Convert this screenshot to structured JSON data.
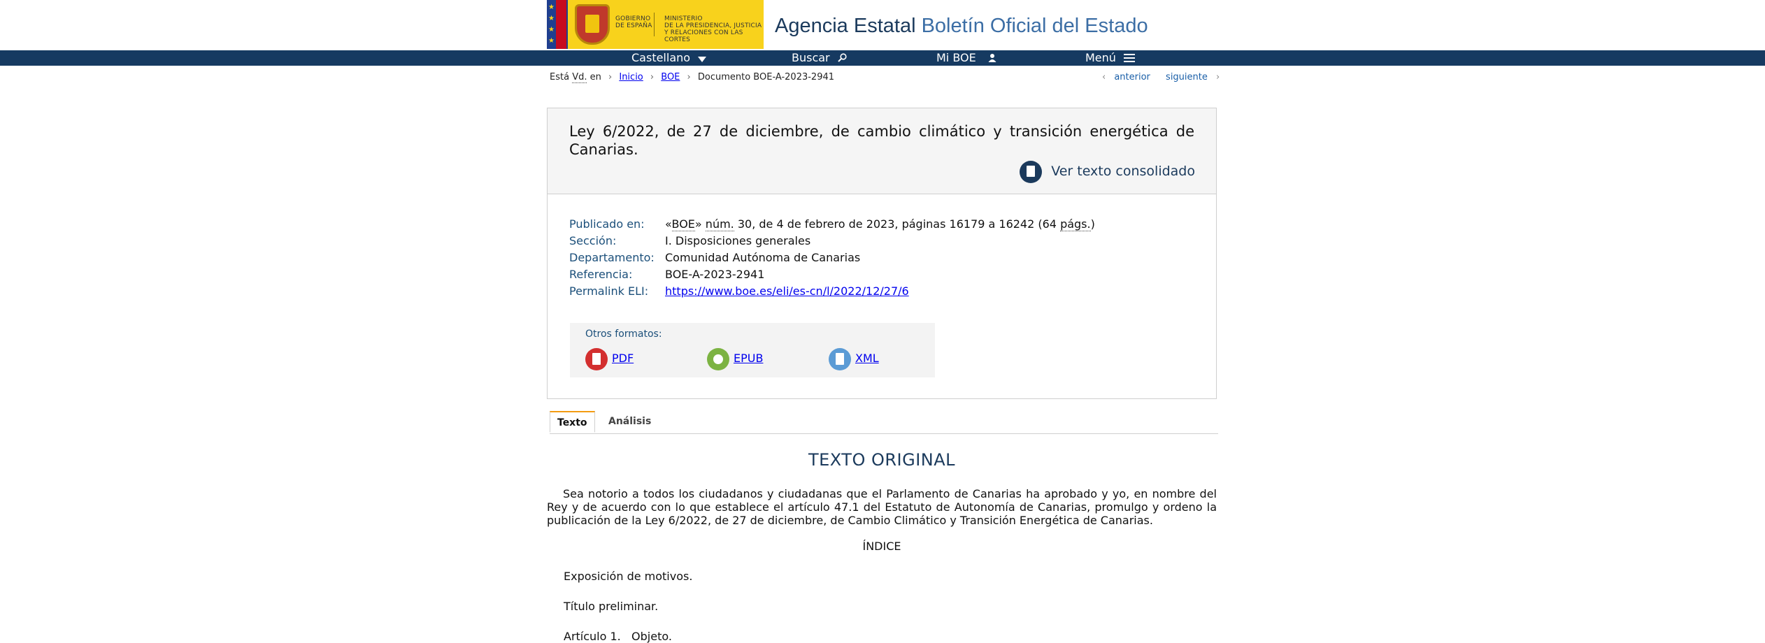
{
  "header": {
    "gov_lines": [
      "GOBIERNO",
      "DE ESPAÑA"
    ],
    "ministry_lines": [
      "MINISTERIO",
      "DE LA PRESIDENCIA, JUSTICIA",
      "Y RELACIONES CON LAS CORTES"
    ],
    "site_title_part1": "Agencia Estatal",
    "site_title_part2": "Boletín Oficial del Estado"
  },
  "nav": {
    "language": "Castellano",
    "search": "Buscar",
    "my_boe": "Mi BOE",
    "menu": "Menú"
  },
  "breadcrumb": {
    "prefix1": "Está",
    "prefix_abbr": "Vd.",
    "prefix2": "en",
    "home": "Inicio",
    "boe": "BOE",
    "current": "Documento BOE-A-2023-2941",
    "previous": "anterior",
    "next": "siguiente"
  },
  "document": {
    "title": "Ley 6/2022, de 27 de diciembre, de cambio climático y transición energética de Canarias.",
    "consolidated_link": "Ver texto consolidado",
    "meta": {
      "published_label": "Publicado en:",
      "published_pre": "«",
      "published_boe": "BOE",
      "published_mid": "» ",
      "published_num": "núm.",
      "published_post": " 30, de 4 de febrero de 2023, páginas 16179 a 16242 (64 ",
      "published_pags": "págs.",
      "published_end": ")",
      "section_label": "Sección:",
      "section_value": "I. Disposiciones generales",
      "department_label": "Departamento:",
      "department_value": "Comunidad Autónoma de Canarias",
      "reference_label": "Referencia:",
      "reference_value": "BOE-A-2023-2941",
      "eli_label": "Permalink ELI:",
      "eli_value": "https://www.boe.es/eli/es-cn/l/2022/12/27/6"
    },
    "formats": {
      "title": "Otros formatos:",
      "pdf": "PDF",
      "epub": "EPUB",
      "xml": "XML"
    }
  },
  "tabs": {
    "text": "Texto",
    "analysis": "Análisis"
  },
  "content": {
    "original_title": "TEXTO ORIGINAL",
    "intro": "Sea notorio a todos los ciudadanos y ciudadanas que el Parlamento de Canarias ha aprobado y yo, en nombre del Rey y de acuerdo con lo que establece el artículo 47.1 del Estatuto de Autonomía de Canarias, promulgo y ordeno la publicación de la Ley 6/2022, de 27 de diciembre, de Cambio Climático y Transición Energética de Canarias.",
    "index_title": "ÍNDICE",
    "index_items": [
      "Exposición de motivos.",
      "Título preliminar.",
      "Artículo 1.   Objeto."
    ]
  },
  "colors": {
    "navbar": "#163a61",
    "gov_yellow": "#f8d21c",
    "pdf_icon": "#d32f2f",
    "epub_icon": "#7cb342",
    "xml_icon": "#5b9bd5",
    "tab_accent": "#f39c12"
  }
}
